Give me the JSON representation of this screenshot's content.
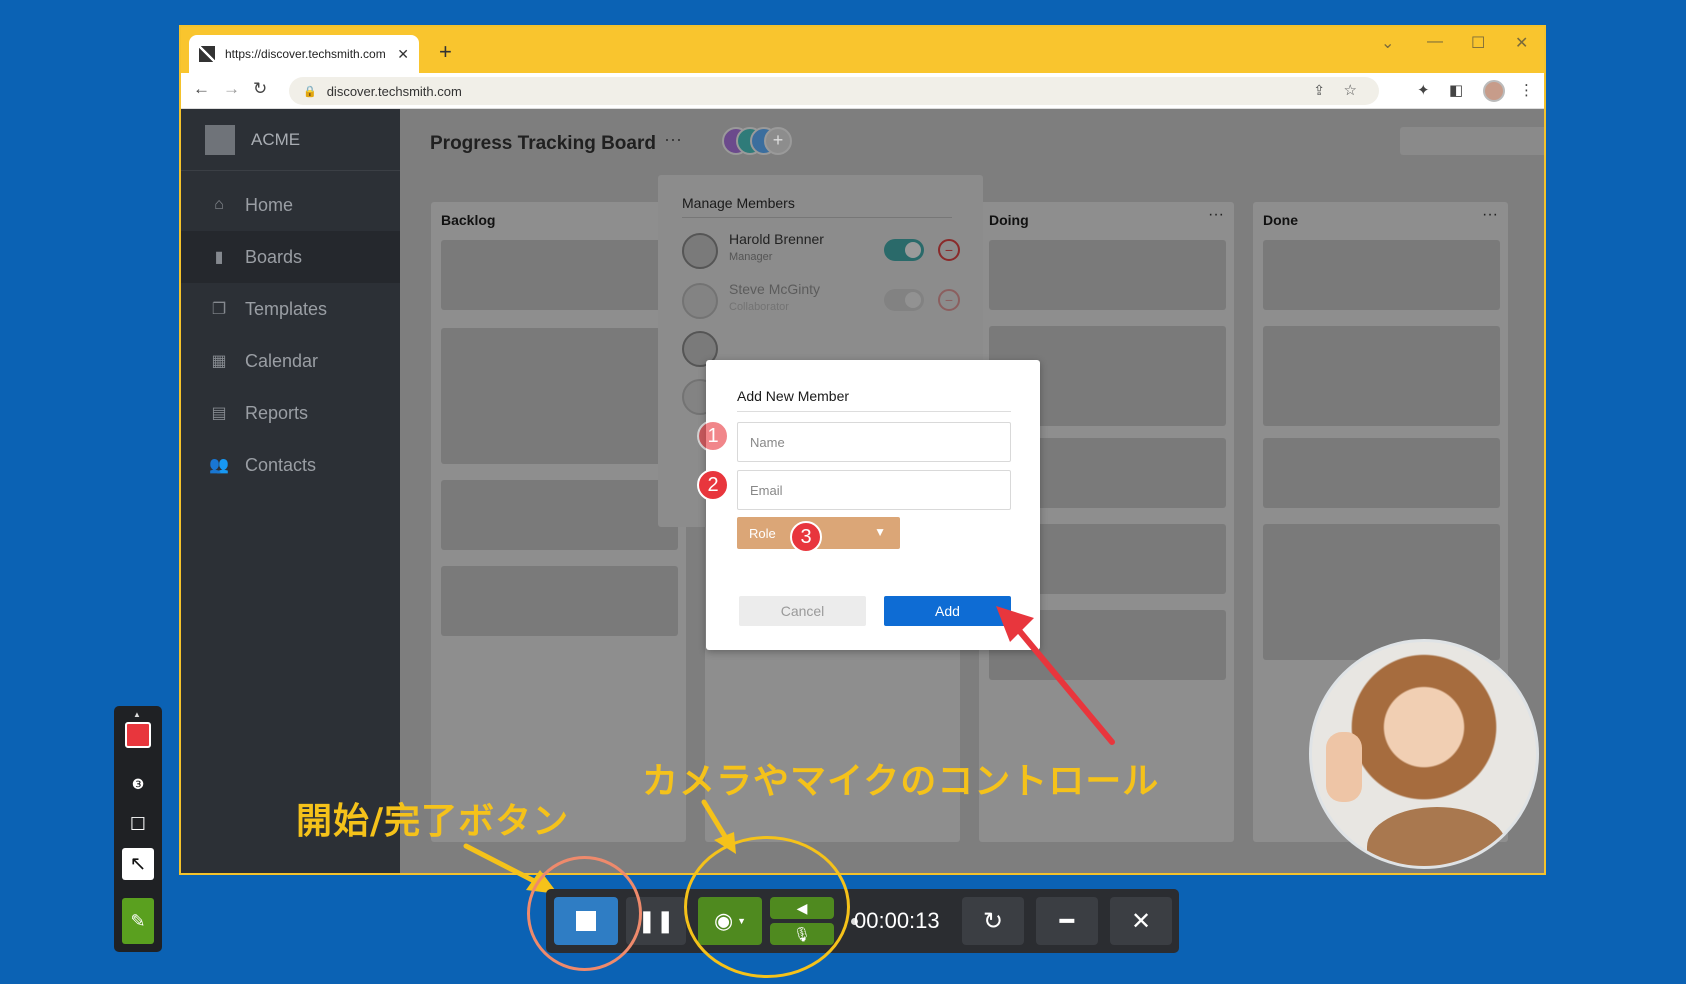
{
  "browser": {
    "tab_title": "https://discover.techsmith.com",
    "tab_close": "✕",
    "new_tab": "+",
    "address": "discover.techsmith.com"
  },
  "app": {
    "brand": "ACME",
    "nav": [
      {
        "label": "Home",
        "icon": "home-icon"
      },
      {
        "label": "Boards",
        "icon": "clipboard-icon",
        "active": true
      },
      {
        "label": "Templates",
        "icon": "copy-icon"
      },
      {
        "label": "Calendar",
        "icon": "calendar-icon"
      },
      {
        "label": "Reports",
        "icon": "document-icon"
      },
      {
        "label": "Contacts",
        "icon": "users-icon"
      }
    ],
    "board_title": "Progress Tracking Board",
    "board_more": "···",
    "columns": [
      {
        "title": "Backlog"
      },
      {
        "title": "Doing",
        "more": "···"
      },
      {
        "title": "Done",
        "more": "···"
      }
    ],
    "help": "?"
  },
  "manage_members": {
    "title": "Manage Members",
    "members": [
      {
        "name": "Harold Brenner",
        "role": "Manager"
      },
      {
        "name": "Steve McGinty",
        "role": "Collaborator"
      }
    ]
  },
  "dialog": {
    "title": "Add New Member",
    "name_placeholder": "Name",
    "email_placeholder": "Email",
    "role_label": "Role",
    "cancel_label": "Cancel",
    "add_label": "Add",
    "steps": [
      "1",
      "2",
      "3"
    ]
  },
  "annotations": {
    "camera_mic": "カメラやマイクのコントロール",
    "start_stop": "開始/完了ボタン"
  },
  "recorder": {
    "timer": "00:00:13"
  },
  "colors": {
    "background": "#0b62b4",
    "browser_frame": "#f9c52e",
    "accent_blue": "#0e6cd4",
    "role_select": "#dba677",
    "step_badge": "#e8363d",
    "annotation": "#f5c21a",
    "record_green": "#4f8a1f",
    "stop_blue": "#2f7dc4"
  }
}
